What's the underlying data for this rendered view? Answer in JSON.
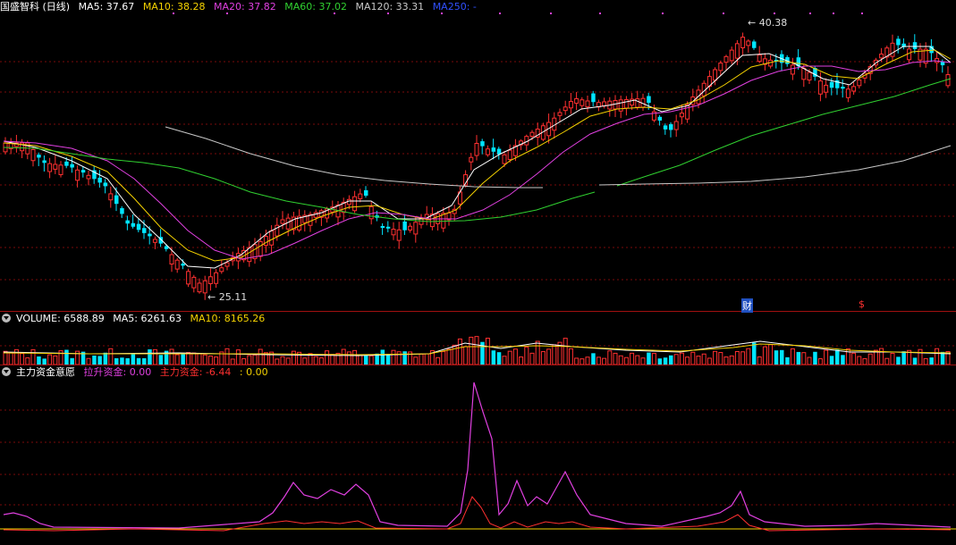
{
  "title": "国盛智科 (日线)",
  "main": {
    "ma": [
      {
        "label": "MA5: 37.67",
        "color": "#ffffff"
      },
      {
        "label": "MA10: 38.28",
        "color": "#f5d200"
      },
      {
        "label": "MA20: 37.82",
        "color": "#e040e0"
      },
      {
        "label": "MA60: 37.02",
        "color": "#30d030"
      },
      {
        "label": "MA120: 33.31",
        "color": "#c8c8c8"
      },
      {
        "label": "MA250: -",
        "color": "#3050ff"
      }
    ],
    "high_label": "40.38",
    "low_label": "25.11",
    "marker_cai": "财",
    "marker_s": "$"
  },
  "volume": {
    "label": "VOLUME: 6588.89",
    "ma5": "MA5: 6261.63",
    "ma10": "MA10: 8165.26"
  },
  "indicator": {
    "name": "主力资金意愿",
    "lashen_label": "拉升资金: 0.00",
    "zhuli_label": "主力资金: -6.44",
    "other_label": ": 0.00"
  },
  "colors": {
    "up": "#ff3030",
    "down": "#00e5ff",
    "ma5": "#ffffff",
    "ma10": "#f5d200",
    "ma20": "#e040e0",
    "ma60": "#30d030",
    "ma120": "#c8c8c8",
    "lashen": "#e040e0",
    "zhuli": "#ff3030",
    "zero": "#f5d200"
  }
}
